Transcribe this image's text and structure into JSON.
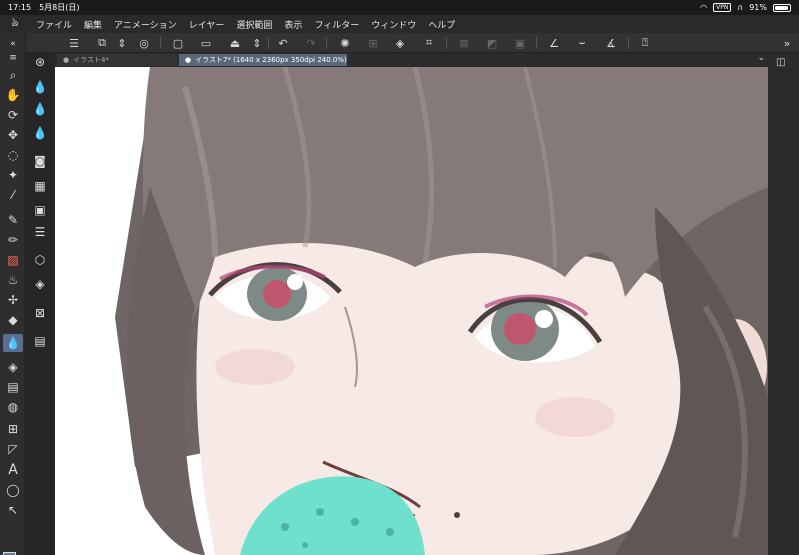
{
  "status": {
    "time": "17:15",
    "date": "5月8日(日)",
    "vpn": "VPN",
    "battery": "91%"
  },
  "menu": {
    "items": [
      "ファイル",
      "編集",
      "アニメーション",
      "レイヤー",
      "選択範囲",
      "表示",
      "フィルター",
      "ウィンドウ",
      "ヘルプ"
    ]
  },
  "tabs": [
    {
      "label": "イラスト4*"
    },
    {
      "label": "イラスト7* (1640 x 2360px 350dpi 240.0%)"
    }
  ],
  "colors": {
    "main": "#6b7b9a",
    "sub": "#ffffff",
    "active_tool": "#5a6f93"
  },
  "icons": {
    "app": "clip-studio-logo-icon",
    "menu": "hamburger-menu-icon"
  }
}
